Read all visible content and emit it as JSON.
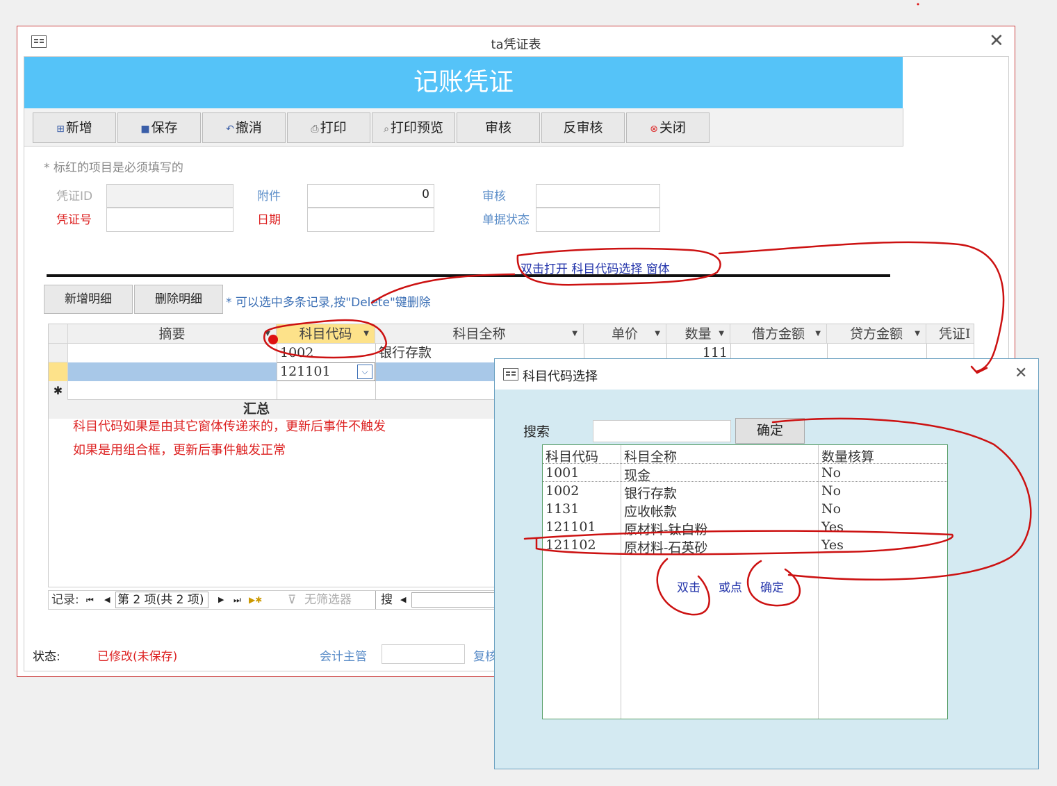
{
  "window": {
    "title": "ta凭证表",
    "close_glyph": "✕"
  },
  "header": {
    "title": "记账凭证"
  },
  "toolbar": {
    "new": "新增",
    "save": "保存",
    "undo": "撤消",
    "print": "打印",
    "preview": "打印预览",
    "audit": "审核",
    "unaudit": "反审核",
    "close": "关闭"
  },
  "form": {
    "required_note": "* 标红的项目是必须填写的",
    "voucher_id_label": "凭证ID",
    "voucher_no_label": "凭证号",
    "attach_label": "附件",
    "attach_value": "0",
    "date_label": "日期",
    "audit_label": "审核",
    "doc_status_label": "单据状态"
  },
  "detail": {
    "add_label": "新增明细",
    "delete_label": "删除明细",
    "hint": "* 可以选中多条记录,按\"Delete\"键删除"
  },
  "grid": {
    "headers": [
      "摘要",
      "科目代码",
      "科目全称",
      "单价",
      "数量",
      "借方金额",
      "贷方金额",
      "凭证I"
    ],
    "rows": [
      {
        "code": "1002",
        "name": "银行存款",
        "qty": "111"
      },
      {
        "code": "121101",
        "name": "",
        "qty": ""
      }
    ],
    "new_row_glyph": "✱",
    "summary_label": "汇总"
  },
  "nav": {
    "label": "记录:",
    "position": "第 2 项(共 2 项)",
    "filter": "无筛选器",
    "search": "搜"
  },
  "status": {
    "label": "状态:",
    "value": "已修改(未保存)",
    "accountant_label": "会计主管",
    "review_label": "复核"
  },
  "annotations": {
    "top": "双击打开  科目代码选择  窗体",
    "line1": "科目代码如果是由其它窗体传递来的，更新后事件不触发",
    "line2": "如果是用组合框，更新后事件触发正常",
    "dbl": "双击",
    "or": "或点",
    "ok": "确定"
  },
  "picker": {
    "title": "科目代码选择",
    "search_label": "搜索",
    "search_value": "",
    "ok_label": "确定",
    "columns": [
      "科目代码",
      "科目全称",
      "数量核算"
    ],
    "rows": [
      {
        "code": "1001",
        "name": "现金",
        "qty": "No"
      },
      {
        "code": "1002",
        "name": "银行存款",
        "qty": "No"
      },
      {
        "code": "1131",
        "name": "应收帐款",
        "qty": "No"
      },
      {
        "code": "121101",
        "name": "原材料-钛白粉",
        "qty": "Yes"
      },
      {
        "code": "121102",
        "name": "原材料-石英砂",
        "qty": "Yes"
      }
    ]
  },
  "colors": {
    "accent": "#55c3f8",
    "required": "#dd2222",
    "ink": "#cc1111",
    "dialog_bg": "#d4eaf2"
  }
}
